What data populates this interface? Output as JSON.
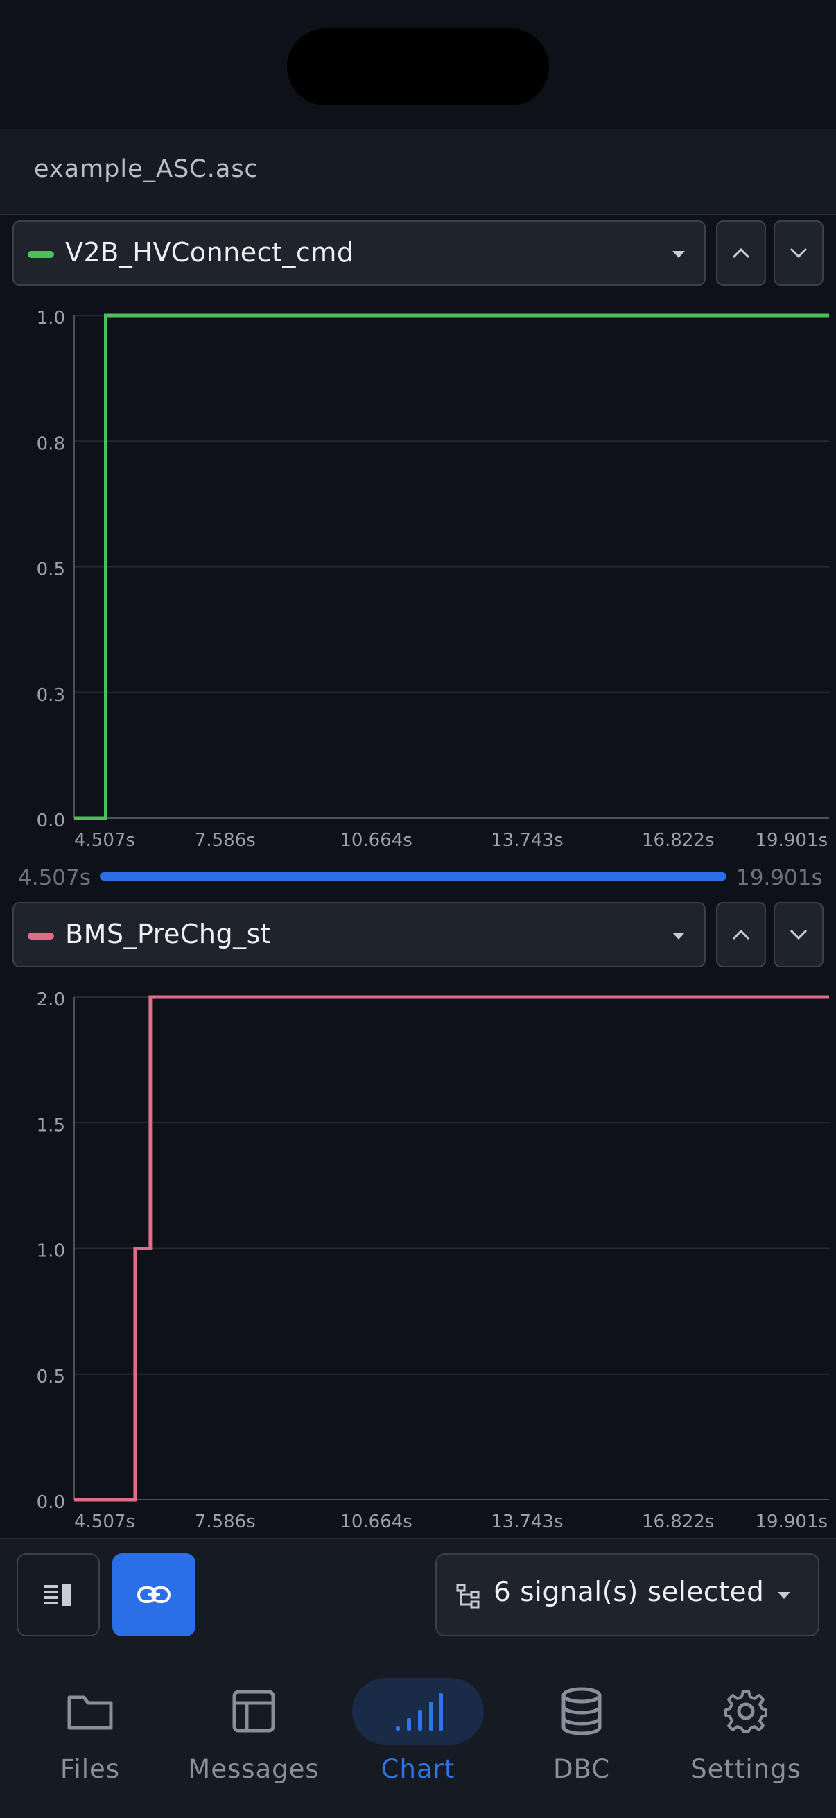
{
  "header": {
    "file_name": "example_ASC.asc"
  },
  "range": {
    "start_label": "4.507s",
    "end_label": "19.901s"
  },
  "charts": [
    {
      "signal": "V2B_HVConnect_cmd",
      "color": "#4cc15a",
      "selector_label": "V2B_HVConnect_cmd"
    },
    {
      "signal": "BMS_PreChg_st",
      "color": "#e06c8a",
      "selector_label": "BMS_PreChg_st"
    }
  ],
  "chart_data": [
    {
      "type": "line",
      "title": "",
      "xlabel": "",
      "ylabel": "",
      "series": [
        {
          "name": "V2B_HVConnect_cmd",
          "step": true,
          "x": [
            4.507,
            5.15,
            5.15,
            19.901
          ],
          "y": [
            0,
            0,
            1,
            1
          ]
        }
      ],
      "xlim": [
        4.507,
        19.901
      ],
      "ylim": [
        0,
        1
      ],
      "x_ticks": [
        "4.507s",
        "7.586s",
        "10.664s",
        "13.743s",
        "16.822s",
        "19.901s"
      ],
      "y_ticks": [
        "0.0",
        "0.3",
        "0.5",
        "0.8",
        "1.0"
      ],
      "grid": true
    },
    {
      "type": "line",
      "title": "",
      "xlabel": "",
      "ylabel": "",
      "series": [
        {
          "name": "BMS_PreChg_st",
          "step": true,
          "x": [
            4.507,
            5.75,
            5.75,
            6.06,
            6.06,
            19.901
          ],
          "y": [
            0,
            0,
            1,
            1,
            2,
            2
          ]
        }
      ],
      "xlim": [
        4.507,
        19.901
      ],
      "ylim": [
        0,
        2
      ],
      "x_ticks": [
        "4.507s",
        "7.586s",
        "10.664s",
        "13.743s",
        "16.822s",
        "19.901s"
      ],
      "y_ticks": [
        "0.0",
        "0.5",
        "1.0",
        "1.5",
        "2.0"
      ],
      "grid": true
    }
  ],
  "toolbar": {
    "selection_label": "6 signal(s) selected"
  },
  "tabs": [
    {
      "label": "Files",
      "icon": "folder-icon",
      "active": false
    },
    {
      "label": "Messages",
      "icon": "table-icon",
      "active": false
    },
    {
      "label": "Chart",
      "icon": "bar-chart-icon",
      "active": true
    },
    {
      "label": "DBC",
      "icon": "database-icon",
      "active": false
    },
    {
      "label": "Settings",
      "icon": "gear-icon",
      "active": false
    }
  ],
  "colors": {
    "accent": "#2a6fe8",
    "background": "#0e1118"
  }
}
